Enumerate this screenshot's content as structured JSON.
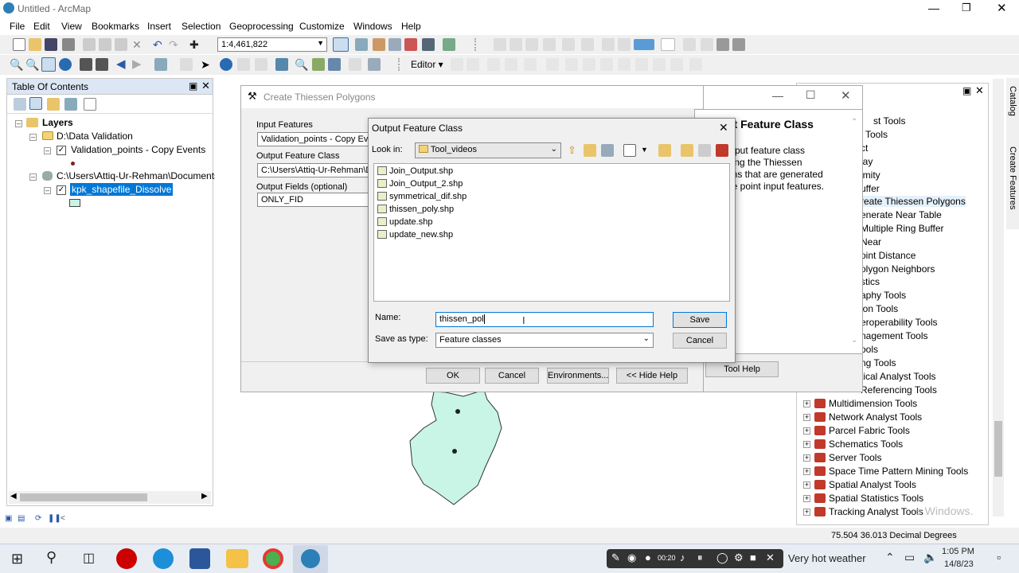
{
  "app": {
    "title": "Untitled - ArcMap"
  },
  "menu": [
    "File",
    "Edit",
    "View",
    "Bookmarks",
    "Insert",
    "Selection",
    "Geoprocessing",
    "Customize",
    "Windows",
    "Help"
  ],
  "toolbar": {
    "scale": "1:4,461,822",
    "editor_label": "Editor ▾"
  },
  "toc": {
    "title": "Table Of Contents",
    "layers_label": "Layers",
    "group1": "D:\\Data Validation",
    "layer1": "Validation_points - Copy Events",
    "group2": "C:\\Users\\Attiq-Ur-Rehman\\Documents",
    "layer2": "kpk_shapefile_Dissolve"
  },
  "toolbox": {
    "items_partial": [
      "st Tools",
      "Tools",
      "ct",
      "lay",
      "imity",
      "uffer",
      "reate Thiessen Polygons",
      "enerate Near Table",
      "Multiple Ring Buffer",
      "Near",
      "oint Distance",
      "olygon Neighbors",
      "stics",
      "aphy Tools",
      "ion Tools",
      "eroperability Tools",
      "nagement Tools",
      "ools",
      "ng Tools",
      "tical Analyst Tools",
      "Referencing Tools"
    ],
    "items": [
      "Multidimension Tools",
      "Network Analyst Tools",
      "Parcel Fabric Tools",
      "Schematics Tools",
      "Server Tools",
      "Space Time Pattern Mining Tools",
      "Spatial Analyst Tools",
      "Spatial Statistics Tools",
      "Tracking Analyst Tools"
    ]
  },
  "gp": {
    "title": "Create Thiessen Polygons",
    "input_label": "Input Features",
    "input_value": "Validation_points - Copy Ev",
    "output_label": "Output Feature Class",
    "output_value": "C:\\Users\\Attiq-Ur-Rehman\\Do",
    "fields_label": "Output Fields (optional)",
    "fields_value": "ONLY_FID",
    "ok": "OK",
    "cancel": "Cancel",
    "env": "Environments...",
    "hide": "<< Hide Help",
    "toolhelp": "Tool Help",
    "help_title": "ut Feature Class",
    "help_text": "utput feature class\nning the Thiessen\nons that are generated\nhe point input features."
  },
  "dialog": {
    "title": "Output Feature Class",
    "lookin_label": "Look in:",
    "lookin_value": "Tool_videos",
    "files": [
      "Join_Output.shp",
      "Join_Output_2.shp",
      "symmetrical_dif.shp",
      "thissen_poly.shp",
      "update.shp",
      "update_new.shp"
    ],
    "name_label": "Name:",
    "name_value": "thissen_pol",
    "type_label": "Save as type:",
    "type_value": "Feature classes",
    "save": "Save",
    "cancel": "Cancel"
  },
  "status": {
    "coords": "75.504  36.013 Decimal Degrees"
  },
  "taskbar": {
    "weather": "Very hot weather",
    "time": "1:05 PM",
    "date": "14/8/23",
    "rec": "00:20"
  },
  "watermark": "e Windows.",
  "side_tabs": [
    "Catalog",
    "Create Features"
  ]
}
